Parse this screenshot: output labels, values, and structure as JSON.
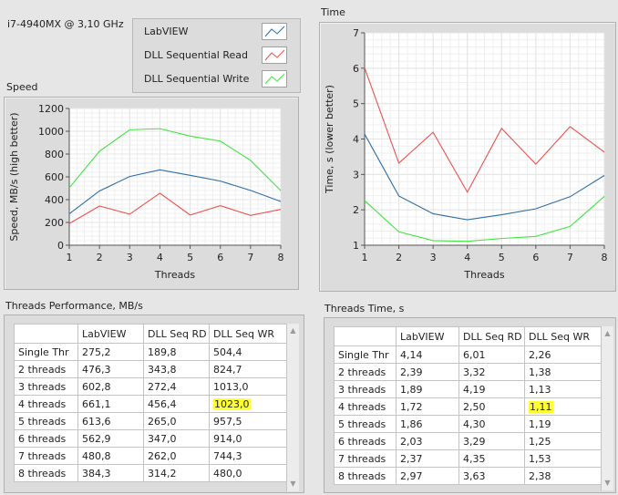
{
  "cpu_label": "i7-4940MX @ 3,10 GHz",
  "legend": {
    "items": [
      {
        "label": "LabVIEW",
        "color": "#2e6da4"
      },
      {
        "label": "DLL Sequential Read",
        "color": "#f05050"
      },
      {
        "label": "DLL Sequential Write",
        "color": "#3ee63e"
      }
    ]
  },
  "speed_panel": {
    "title": "Speed"
  },
  "time_panel": {
    "title": "Time"
  },
  "chart_data": [
    {
      "type": "line",
      "title": "Speed",
      "xlabel": "Threads",
      "ylabel": "Speed, MB/s (high better)",
      "x": [
        1,
        2,
        3,
        4,
        5,
        6,
        7,
        8
      ],
      "xlim": [
        1,
        8
      ],
      "ylim": [
        0,
        1200
      ],
      "yticks": [
        0,
        200,
        400,
        600,
        800,
        1000,
        1200
      ],
      "series": [
        {
          "name": "LabVIEW",
          "values": [
            275.2,
            476.3,
            602.8,
            661.1,
            613.6,
            562.9,
            480.8,
            384.3
          ]
        },
        {
          "name": "DLL Sequential Read",
          "values": [
            189.8,
            343.8,
            272.4,
            456.4,
            265.0,
            347.0,
            262.0,
            314.2
          ]
        },
        {
          "name": "DLL Sequential Write",
          "values": [
            504.4,
            824.7,
            1013.0,
            1023.0,
            957.5,
            914.0,
            744.3,
            480.0
          ]
        }
      ],
      "grid": true
    },
    {
      "type": "line",
      "title": "Time",
      "xlabel": "Threads",
      "ylabel": "Time, s (lower better)",
      "x": [
        1,
        2,
        3,
        4,
        5,
        6,
        7,
        8
      ],
      "xlim": [
        1,
        8
      ],
      "ylim": [
        1,
        7
      ],
      "yticks": [
        1,
        2,
        3,
        4,
        5,
        6,
        7
      ],
      "series": [
        {
          "name": "LabVIEW",
          "values": [
            4.14,
            2.39,
            1.89,
            1.72,
            1.86,
            2.03,
            2.37,
            2.97
          ]
        },
        {
          "name": "DLL Sequential Read",
          "values": [
            6.01,
            3.32,
            4.19,
            2.5,
            4.3,
            3.29,
            4.35,
            3.63
          ]
        },
        {
          "name": "DLL Sequential Write",
          "values": [
            2.26,
            1.38,
            1.13,
            1.11,
            1.19,
            1.25,
            1.53,
            2.38
          ]
        }
      ],
      "grid": true
    }
  ],
  "perf_table": {
    "title": "Threads Performance, MB/s",
    "headers": [
      "",
      "LabVIEW",
      "DLL Seq RD",
      "DLL Seq WR"
    ],
    "rows": [
      [
        "Single Thr",
        "275,2",
        "189,8",
        "504,4"
      ],
      [
        "2 threads",
        "476,3",
        "343,8",
        "824,7"
      ],
      [
        "3 threads",
        "602,8",
        "272,4",
        "1013,0"
      ],
      [
        "4 threads",
        "661,1",
        "456,4",
        "1023,0"
      ],
      [
        "5 threads",
        "613,6",
        "265,0",
        "957,5"
      ],
      [
        "6 threads",
        "562,9",
        "347,0",
        "914,0"
      ],
      [
        "7 threads",
        "480,8",
        "262,0",
        "744,3"
      ],
      [
        "8 threads",
        "384,3",
        "314,2",
        "480,0"
      ]
    ],
    "highlight": {
      "row": 3,
      "col": 3
    }
  },
  "time_table": {
    "title": "Threads Time, s",
    "headers": [
      "",
      "LabVIEW",
      "DLL Seq RD",
      "DLL Seq WR"
    ],
    "rows": [
      [
        "Single Thr",
        "4,14",
        "6,01",
        "2,26"
      ],
      [
        "2 threads",
        "2,39",
        "3,32",
        "1,38"
      ],
      [
        "3 threads",
        "1,89",
        "4,19",
        "1,13"
      ],
      [
        "4 threads",
        "1,72",
        "2,50",
        "1,11"
      ],
      [
        "5 threads",
        "1,86",
        "4,30",
        "1,19"
      ],
      [
        "6 threads",
        "2,03",
        "3,29",
        "1,25"
      ],
      [
        "7 threads",
        "2,37",
        "4,35",
        "1,53"
      ],
      [
        "8 threads",
        "2,97",
        "3,63",
        "2,38"
      ]
    ],
    "highlight": {
      "row": 3,
      "col": 3
    }
  },
  "colors": {
    "highlight": "#ffff33",
    "grid": "#e4e4e4",
    "plot_bg": "#ffffff"
  }
}
